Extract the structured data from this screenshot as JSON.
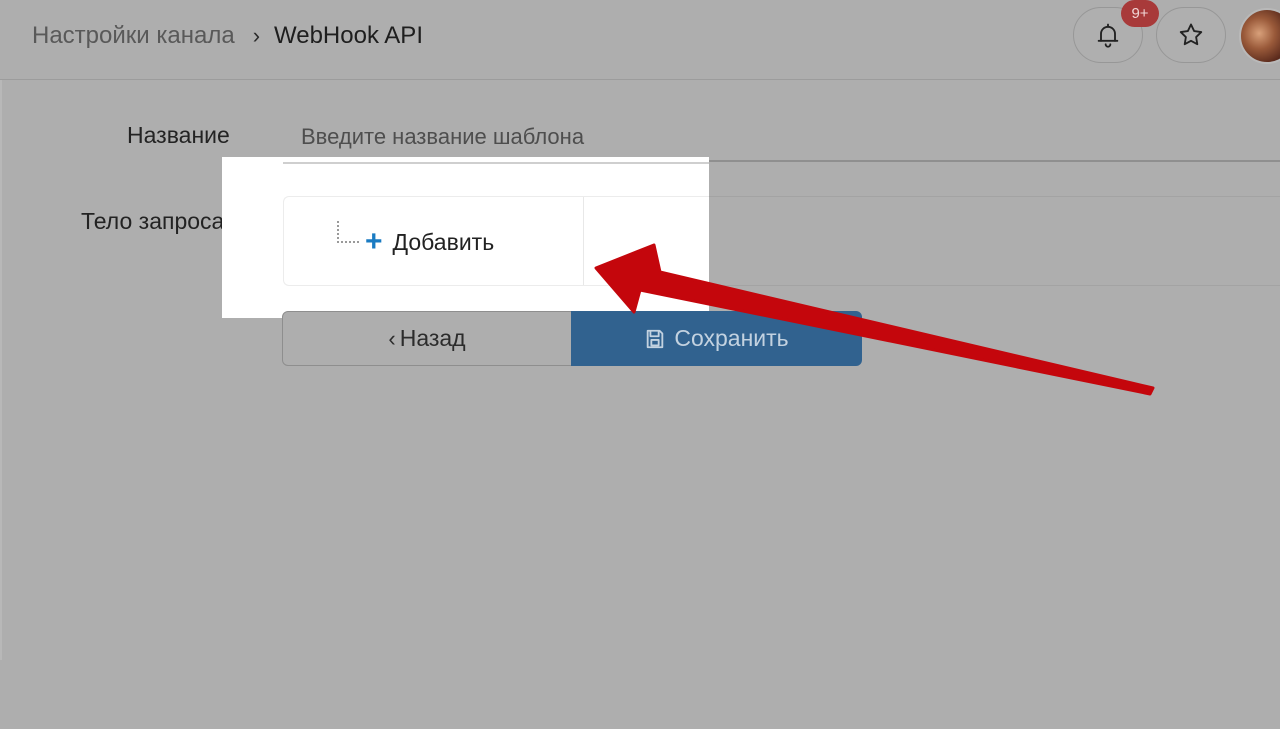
{
  "header": {
    "breadcrumb_parent": "Настройки канала",
    "breadcrumb_separator": "›",
    "breadcrumb_current": "WebHook API",
    "notification_badge": "9+",
    "badge_color": "#a83a3a"
  },
  "form": {
    "name_label": "Название",
    "name_placeholder": "Введите название шаблона",
    "body_label": "Тело запроса",
    "add_label": "Добавить",
    "plus_icon": "+",
    "back_chevron": "‹",
    "back_label": "Назад",
    "save_label": "Сохранить",
    "save_color": "#31628f",
    "accent_color": "#1a7bc2"
  },
  "icons": {
    "bell": "bell-icon",
    "star": "star-icon",
    "save": "floppy-disk-icon",
    "annotation": "red-arrow"
  }
}
